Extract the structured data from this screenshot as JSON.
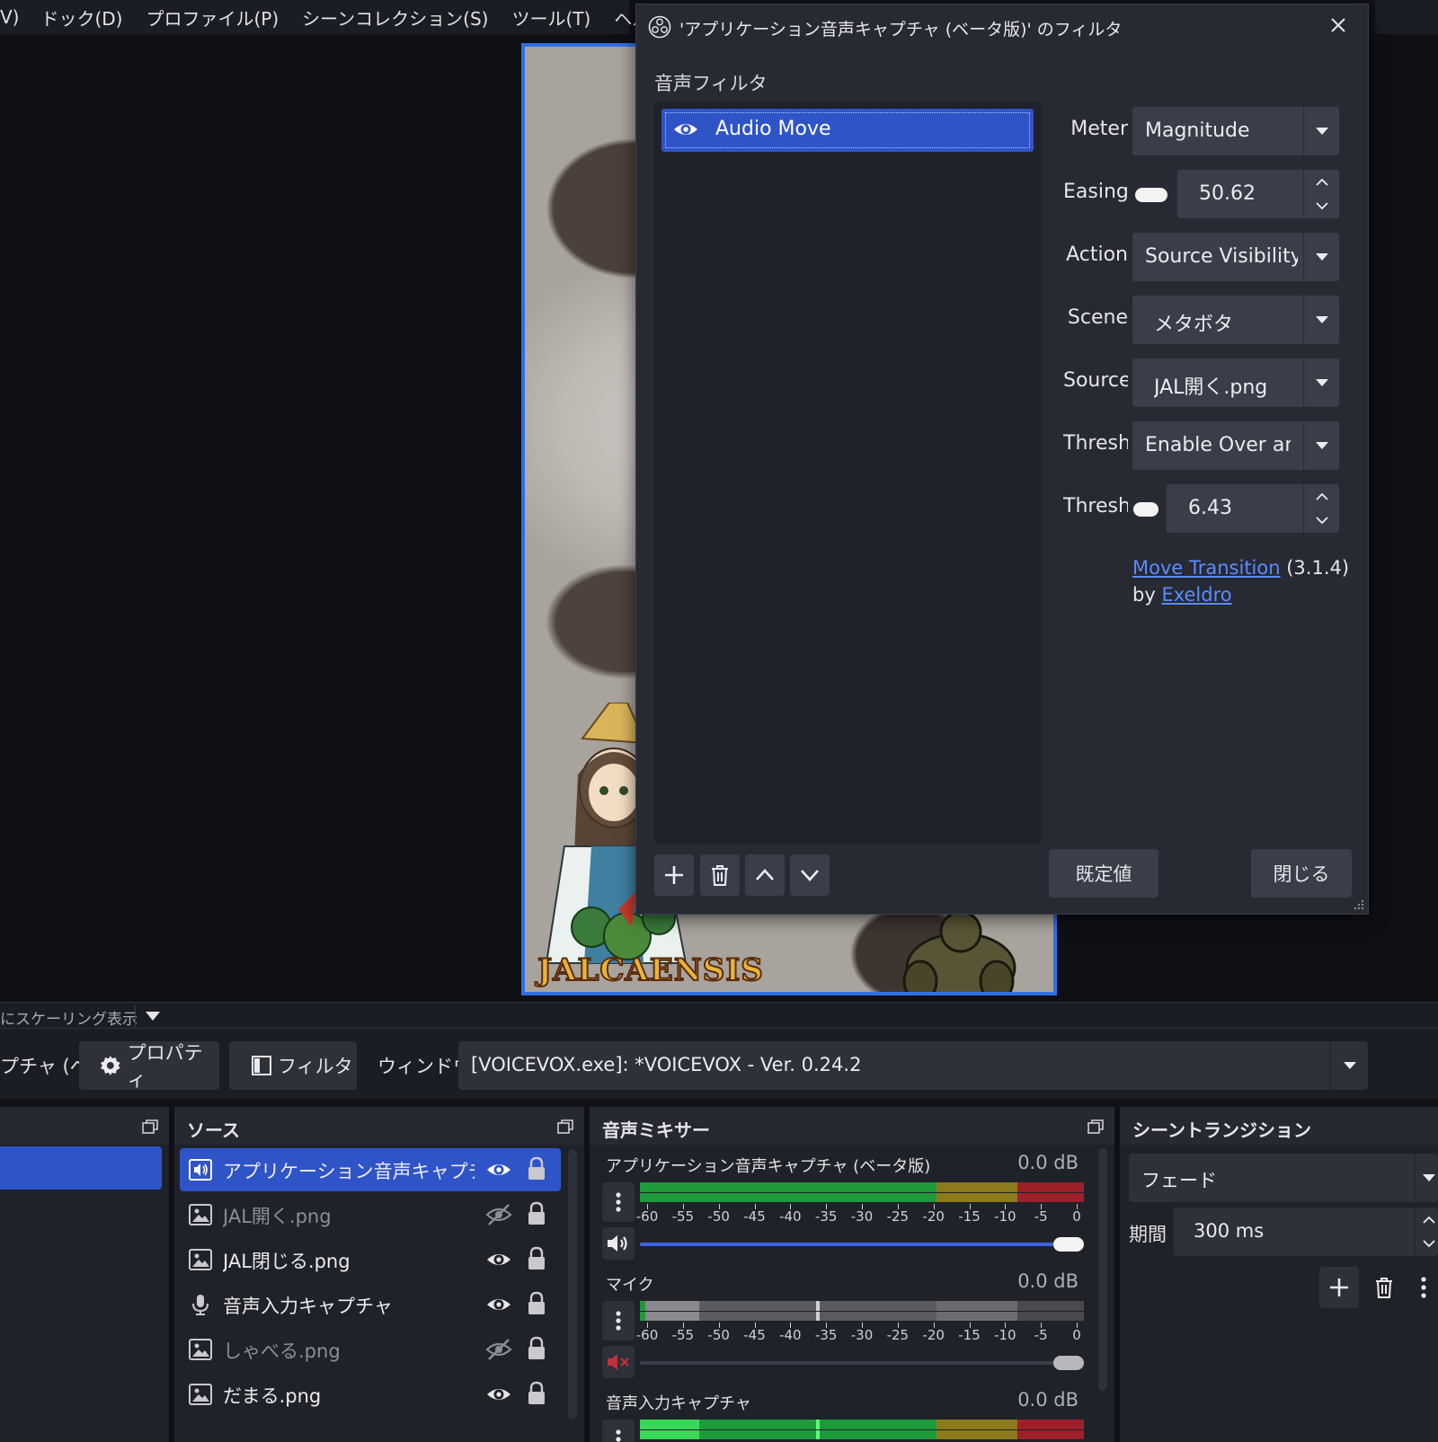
{
  "menu": {
    "items": [
      "V)",
      "ドック(D)",
      "プロファイル(P)",
      "シーンコレクション(S)",
      "ツール(T)",
      "ヘルプ(H)"
    ]
  },
  "preview": {
    "logo_text": "JALCAENSIS"
  },
  "dialog": {
    "title": "'アプリケーション音声キャプチャ (ベータ版)' のフィルタ",
    "section_label": "音声フィルタ",
    "filters": [
      {
        "label": "Audio Move",
        "enabled": true,
        "selected": true
      }
    ],
    "properties": {
      "meter": {
        "label": "Meter",
        "value": "Magnitude"
      },
      "easing": {
        "label": "Easing",
        "value": "50.62"
      },
      "action": {
        "label": "Action",
        "value": "Source Visibility"
      },
      "scene": {
        "label": "Scene",
        "value": "メタボタ"
      },
      "source": {
        "label": "Source",
        "value": "JAL開く.png"
      },
      "threshold_mode": {
        "label": "Thresh",
        "value": "Enable Over and"
      },
      "threshold": {
        "label": "Thresh",
        "value": "6.43"
      }
    },
    "plugin_credit": {
      "link_text": "Move Transition",
      "version": "(3.1.4)",
      "by": "by",
      "author": "Exeldro"
    },
    "defaults_button": "既定値",
    "close_button": "閉じる"
  },
  "scale_bar": {
    "text": "にスケーリング表示"
  },
  "toolbar": {
    "source_name": "プチャ (ベ",
    "properties_button": "プロパティ",
    "filters_button": "フィルタ",
    "window_label": "ウィンドウ",
    "window_value": "[VOICEVOX.exe]: *VOICEVOX - Ver. 0.24.2"
  },
  "sources_dock": {
    "title": "ソース",
    "items": [
      {
        "name": "アプリケーション音声キャプチャ (ベータ版)",
        "type": "audio-output",
        "visible": true,
        "selected": true
      },
      {
        "name": "JAL開く.png",
        "type": "image",
        "visible": false
      },
      {
        "name": "JAL閉じる.png",
        "type": "image",
        "visible": true
      },
      {
        "name": "音声入力キャプチャ",
        "type": "microphone",
        "visible": true
      },
      {
        "name": "しゃべる.png",
        "type": "image",
        "visible": false
      },
      {
        "name": "だまる.png",
        "type": "image",
        "visible": true
      }
    ]
  },
  "mixer_dock": {
    "title": "音声ミキサー",
    "scale_ticks": [
      "-60",
      "-55",
      "-50",
      "-45",
      "-40",
      "-35",
      "-30",
      "-25",
      "-20",
      "-15",
      "-10",
      "-5",
      "0"
    ],
    "channels": [
      {
        "name": "アプリケーション音声キャプチャ (ベータ版)",
        "db": "0.0 dB",
        "muted": false,
        "active": true
      },
      {
        "name": "マイク",
        "db": "0.0 dB",
        "muted": true,
        "active": false
      },
      {
        "name": "音声入力キャプチャ",
        "db": "0.0 dB",
        "muted": false,
        "active": true
      }
    ]
  },
  "transitions_dock": {
    "title": "シーントランジション",
    "transition": "フェード",
    "duration_label": "期間",
    "duration": "300 ms"
  },
  "colors": {
    "accent": "#2f54c8",
    "link": "#5b8cff",
    "meter_green": "#1f9a3b",
    "meter_yellow": "#8c7a1c",
    "meter_red": "#9c1f2a",
    "muted_red": "#c0323b"
  }
}
